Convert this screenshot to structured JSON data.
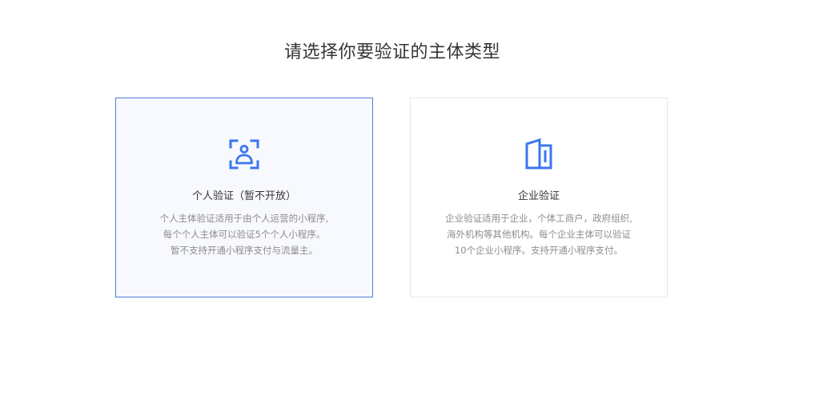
{
  "page": {
    "title": "请选择你要验证的主体类型"
  },
  "cards": [
    {
      "icon": "person-verify-icon",
      "title": "个人验证（暂不开放）",
      "selected": true,
      "description": [
        "个人主体验证适用于由个人运营的小程序,",
        "每个个人主体可以验证5个个人小程序。",
        "暂不支持开通小程序支付与流量主。"
      ]
    },
    {
      "icon": "enterprise-building-icon",
      "title": "企业验证",
      "selected": false,
      "description": [
        "企业验证适用于企业，个体工商户，政府组织,",
        "海外机构等其他机构。每个企业主体可以验证",
        "10个企业小程序。支持开通小程序支付。"
      ]
    }
  ],
  "colors": {
    "accent": "#3b76f0",
    "selected_border": "#4c7ddb",
    "selected_background": "#f7f9fe",
    "card_border": "#e7e7eb",
    "title_text": "#353535",
    "description_text": "#8d8d8d"
  }
}
